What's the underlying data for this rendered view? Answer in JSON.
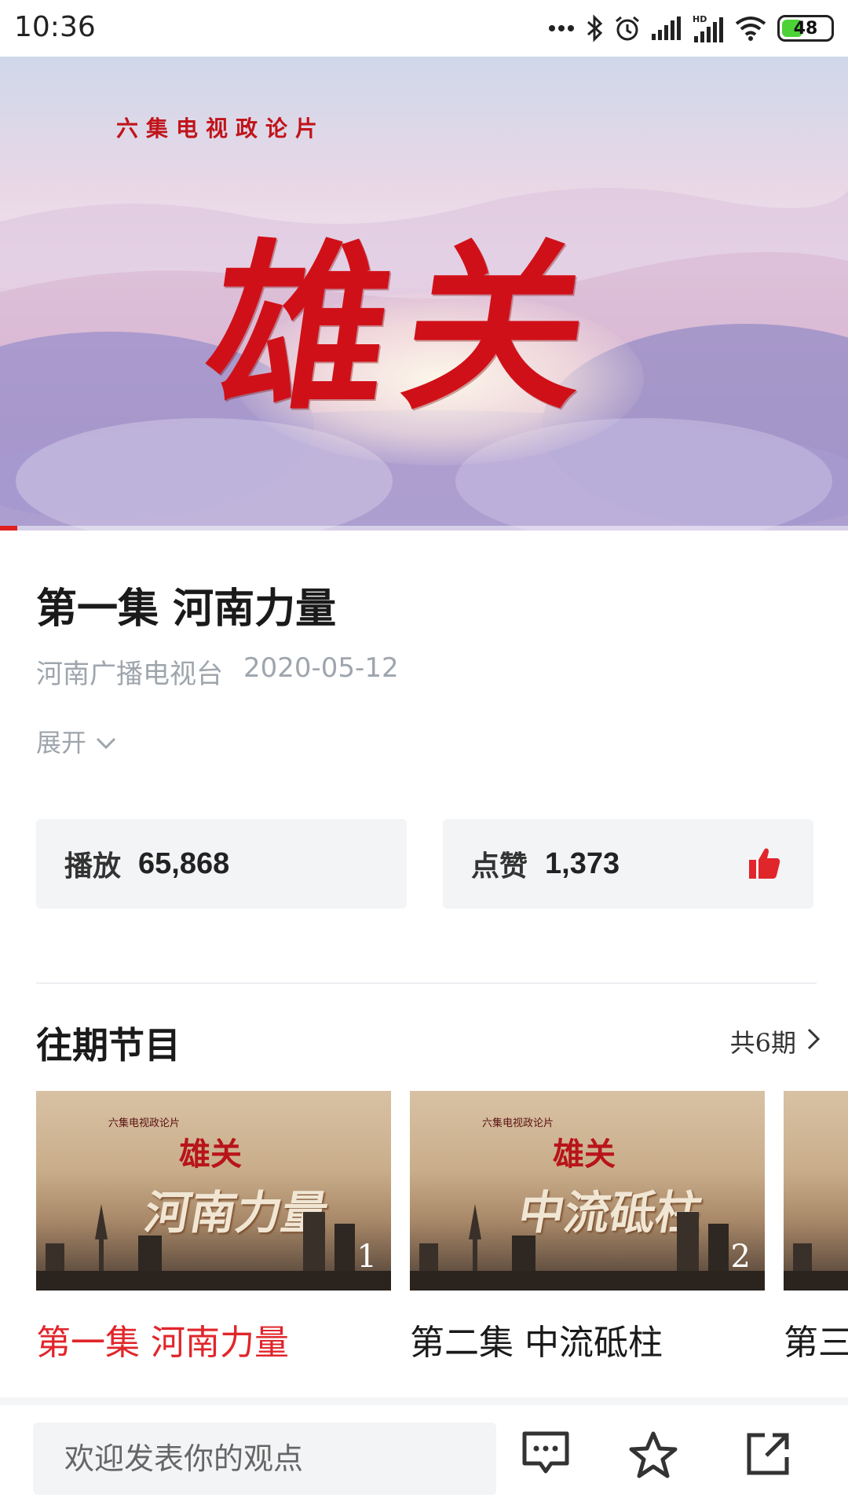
{
  "status_bar": {
    "time": "10:36",
    "battery": "48",
    "icons": [
      "more-dots-icon",
      "bluetooth-icon",
      "alarm-icon",
      "signal-icon",
      "hd-signal-icon",
      "wifi-icon",
      "battery-icon"
    ]
  },
  "hero": {
    "subtitle": "六集电视政论片",
    "title": "雄关",
    "progress_fraction": 0.02,
    "accent_color": "#e02020"
  },
  "episode": {
    "title": "第一集 河南力量",
    "publisher": "河南广播电视台",
    "date": "2020-05-12",
    "expand_label": "展开"
  },
  "stats": {
    "play_label": "播放",
    "play_count": "65,868",
    "like_label": "点赞",
    "like_count": "1,373",
    "like_color": "#e0262b"
  },
  "past_episodes": {
    "title": "往期节目",
    "total_label": "共6期",
    "items": [
      {
        "caption": "第一集 河南力量",
        "number": "1",
        "thumb_series": "雄关",
        "thumb_small": "六集电视政论片",
        "thumb_big": "河南力量",
        "active": true
      },
      {
        "caption": "第二集 中流砥柱",
        "number": "2",
        "thumb_series": "雄关",
        "thumb_small": "六集电视政论片",
        "thumb_big": "中流砥柱",
        "active": false
      },
      {
        "caption": "第三",
        "number": "",
        "thumb_series": "",
        "thumb_small": "",
        "thumb_big": "",
        "active": false
      }
    ]
  },
  "bottom_bar": {
    "comment_placeholder": "欢迎发表你的观点",
    "icons": [
      "comment-icon",
      "star-icon",
      "share-icon"
    ]
  }
}
